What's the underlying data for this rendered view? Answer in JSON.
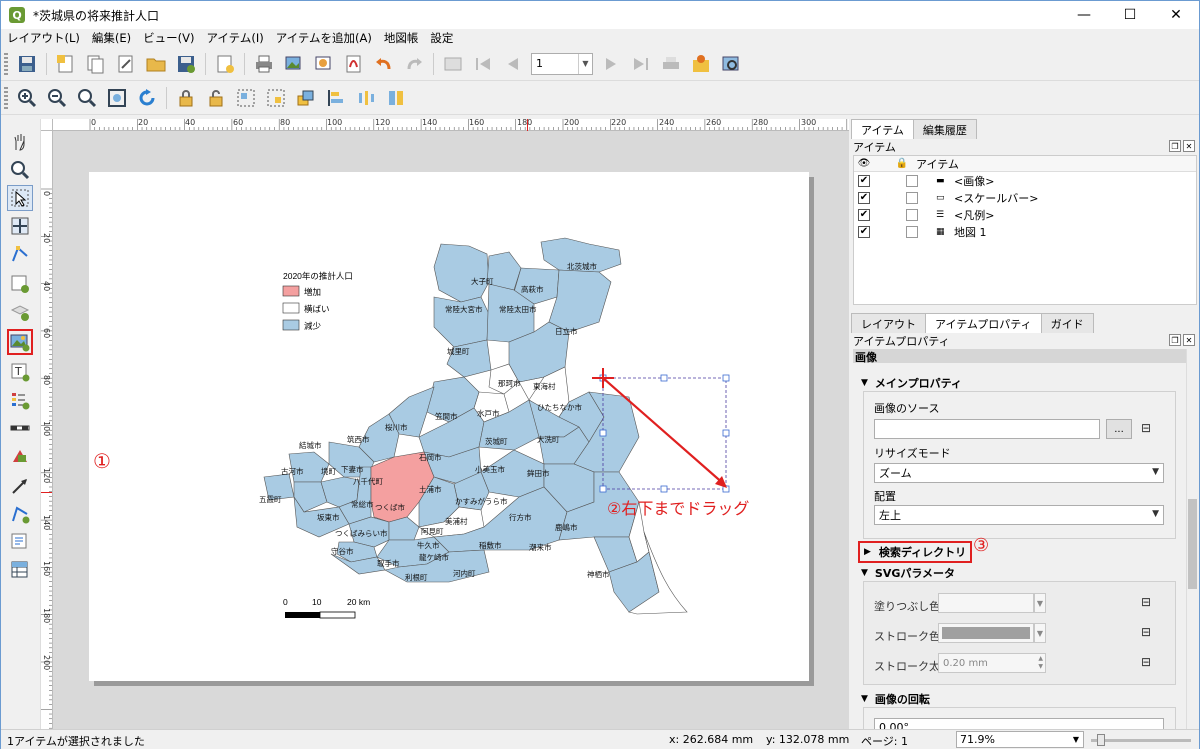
{
  "window": {
    "title": "*茨城県の将来推計人口",
    "min_glyph": "—",
    "max_glyph": "☐",
    "close_glyph": "✕"
  },
  "menu": [
    "レイアウト(L)",
    "編集(E)",
    "ビュー(V)",
    "アイテム(I)",
    "アイテムを追加(A)",
    "地図帳",
    "設定"
  ],
  "toolbar1": {
    "page_spin": "1"
  },
  "layout_map": {
    "legend": {
      "title": "2020年の推計人口",
      "items": [
        {
          "label": "増加",
          "color": "#f4a0a0"
        },
        {
          "label": "横ばい",
          "color": "#ffffff"
        },
        {
          "label": "減少",
          "color": "#a9cbe3"
        }
      ]
    },
    "cities": [
      "北茨城市",
      "大子町",
      "高萩市",
      "常陸大宮市",
      "常陸太田市",
      "日立市",
      "城里町",
      "那珂市",
      "東海村",
      "ひたちなか市",
      "水戸市",
      "笠間市",
      "桜川市",
      "筑西市",
      "結城市",
      "古河市",
      "五霞町",
      "境町",
      "八千代町",
      "下妻市",
      "坂東市",
      "常総市",
      "石岡市",
      "茨城町",
      "大洗町",
      "小美玉市",
      "鉾田市",
      "かすみがうら市",
      "土浦市",
      "行方市",
      "つくば市",
      "つくばみらい市",
      "守谷市",
      "取手市",
      "利根町",
      "阿見町",
      "牛久市",
      "龍ケ崎市",
      "美浦村",
      "稲敷市",
      "潮来市",
      "鹿嶋市",
      "河内町",
      "神栖市"
    ],
    "scalebar": {
      "labels": [
        "0",
        "10",
        "20 km"
      ]
    }
  },
  "annotations": {
    "a1": "①",
    "a2": "②右下までドラッグ",
    "a3": "③"
  },
  "ruler_h": [
    "0",
    "20",
    "40",
    "60",
    "80",
    "100",
    "120",
    "140",
    "160",
    "180",
    "200",
    "220",
    "240",
    "260",
    "280",
    "300"
  ],
  "ruler_v": [
    "0",
    "20",
    "40",
    "60",
    "80",
    "100",
    "120",
    "140",
    "160",
    "180",
    "200"
  ],
  "top_tabs": [
    "アイテム",
    "編集履歴"
  ],
  "items_panel": {
    "title": "アイテム",
    "col_item": "アイテム",
    "rows": [
      {
        "label": "<画像>",
        "icon": "picture-icon"
      },
      {
        "label": "<スケールバー>",
        "icon": "scalebar-icon"
      },
      {
        "label": "<凡例>",
        "icon": "legend-icon"
      },
      {
        "label": "地図 1",
        "icon": "map-icon"
      }
    ]
  },
  "bottom_tabs": [
    "レイアウト",
    "アイテムプロパティ",
    "ガイド"
  ],
  "props": {
    "dock_title": "アイテムプロパティ",
    "header": "画像",
    "main_section": "メインプロパティ",
    "source_label": "画像のソース",
    "source_value": "",
    "browse": "...",
    "resize_label": "リサイズモード",
    "resize_value": "ズーム",
    "placement_label": "配置",
    "placement_value": "左上",
    "search_dirs": "検索ディレクトリ",
    "svg_section": "SVGパラメータ",
    "fill_label": "塗りつぶし色",
    "stroke_label": "ストローク色",
    "stroke_width_label": "ストローク太さ",
    "stroke_width_value": "0.20 mm",
    "rotation_section": "画像の回転",
    "rotation_value": "0.00°"
  },
  "status": {
    "selected": "1アイテムが選択されました",
    "x": "x: 262.684 mm",
    "y": "y: 132.078 mm",
    "page": "ページ: 1",
    "zoom": "71.9%"
  }
}
